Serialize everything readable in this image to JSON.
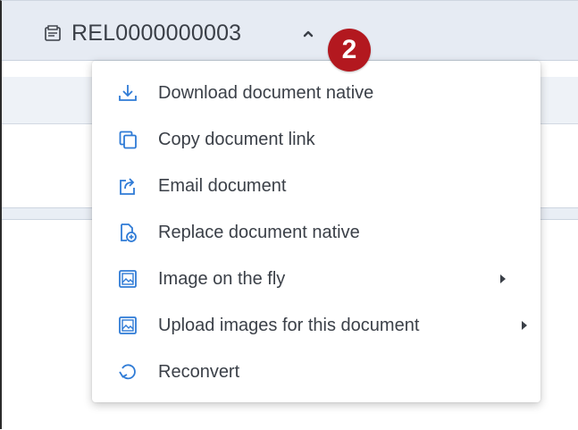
{
  "header": {
    "document_id": "REL0000000003",
    "doc_icon": "document-stack-icon",
    "toggle_icon": "chevron-up-icon",
    "callout_badge": "2"
  },
  "menu": {
    "items": [
      {
        "label": "Download document native",
        "icon": "download-icon",
        "submenu": false
      },
      {
        "label": "Copy document link",
        "icon": "copy-icon",
        "submenu": false
      },
      {
        "label": "Email document",
        "icon": "share-export-icon",
        "submenu": false
      },
      {
        "label": "Replace document native",
        "icon": "replace-document-icon",
        "submenu": false
      },
      {
        "label": "Image on the fly",
        "icon": "image-icon",
        "submenu": true
      },
      {
        "label": "Upload images for this document",
        "icon": "image-icon",
        "submenu": true
      },
      {
        "label": "Reconvert",
        "icon": "reconvert-icon",
        "submenu": false
      }
    ]
  },
  "colors": {
    "icon_blue": "#2f7bd6",
    "badge_red": "#b3181f",
    "header_bg": "#e6ebf3",
    "text": "#3b4048"
  }
}
